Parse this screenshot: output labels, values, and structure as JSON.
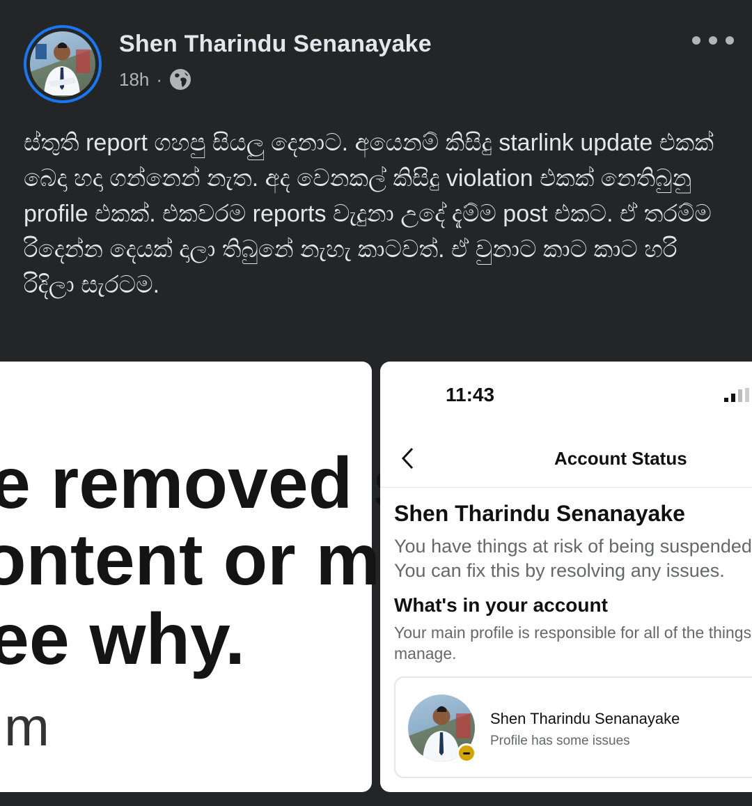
{
  "post": {
    "author": "Shen Tharindu Senanayake",
    "time": "18h",
    "separator": "·",
    "privacy_icon": "globe-icon",
    "more_icon": "more-horizontal-icon",
    "text": "ස්තුති report ගහපු සියලු දෙනාට. අයෙනම් කිසිදු starlink update එකක් බෙදා හදා ගන්නෙන් නැත. අද වෙනකල් කිසිදු violation එකක් නෙතිබුනු profile එකක්. එකවරම reports වැදුනා උදේ දැම්ම post එකට. ඒ තරම්ම රිදෙන්න දෙයක් දාලා තිබුනේ නැහැ කාටවත්. ඒ වුනාට කාට කාට හරි රිදිලා සැරටම."
  },
  "left_image": {
    "line1": "e removed s",
    "line2": "ontent or me",
    "line3": "ee why.",
    "line4": "m"
  },
  "right_image": {
    "status_time": "11:43",
    "header_title": "Account Status",
    "account_name": "Shen Tharindu Senanayake",
    "account_desc": "You have things at risk of being suspended. You can fix this by resolving any issues.",
    "section_title": "What's in your account",
    "section_desc": "Your main profile is responsible for all of the things you manage.",
    "card": {
      "name": "Shen Tharindu Senanayake",
      "status": "Profile has some issues"
    }
  },
  "colors": {
    "background": "#242526",
    "accent": "#1877f2",
    "warning": "#d4a400"
  }
}
